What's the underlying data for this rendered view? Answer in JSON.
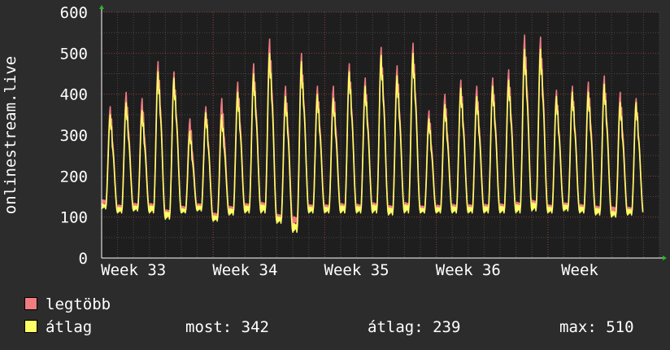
{
  "chart_data": {
    "type": "line",
    "ylabel": "onlinestream.live",
    "ylim": [
      0,
      600
    ],
    "yticks": [
      0,
      100,
      200,
      300,
      400,
      500,
      600
    ],
    "xlim": [
      0,
      35
    ],
    "xticks": [
      {
        "label": "Week 33",
        "day": 2
      },
      {
        "label": "Week 34",
        "day": 9
      },
      {
        "label": "Week 35",
        "day": 16
      },
      {
        "label": "Week 36",
        "day": 23
      },
      {
        "label": "Week",
        "day": 30
      }
    ],
    "grid": true,
    "colors": {
      "max": "#f07c80",
      "avg": "#ffff66"
    },
    "series": [
      {
        "name": "legtöbb",
        "key": "max",
        "daily_peaks": [
          370,
          405,
          390,
          480,
          455,
          340,
          370,
          390,
          430,
          475,
          535,
          420,
          500,
          420,
          420,
          475,
          440,
          515,
          470,
          525,
          360,
          400,
          435,
          420,
          440,
          460,
          545,
          540,
          410,
          420,
          430,
          445,
          405,
          390
        ],
        "daily_lows": [
          130,
          115,
          120,
          115,
          100,
          115,
          120,
          95,
          110,
          115,
          115,
          90,
          80,
          115,
          115,
          115,
          115,
          115,
          110,
          115,
          115,
          115,
          115,
          115,
          115,
          115,
          115,
          120,
          115,
          120,
          115,
          110,
          110,
          110
        ]
      },
      {
        "name": "átlag",
        "key": "avg",
        "daily_peaks": [
          350,
          380,
          360,
          455,
          440,
          310,
          355,
          350,
          405,
          450,
          500,
          395,
          480,
          400,
          390,
          455,
          420,
          495,
          445,
          500,
          340,
          375,
          415,
          395,
          420,
          435,
          510,
          510,
          395,
          405,
          405,
          425,
          380,
          380
        ],
        "daily_lows": [
          120,
          110,
          115,
          110,
          95,
          110,
          115,
          90,
          105,
          110,
          110,
          85,
          63,
          110,
          110,
          110,
          110,
          110,
          105,
          110,
          110,
          110,
          110,
          110,
          110,
          110,
          110,
          115,
          110,
          115,
          110,
          105,
          100,
          105
        ]
      }
    ]
  },
  "legend": {
    "items": [
      {
        "label": "legtöbb",
        "color": "#f07c80"
      },
      {
        "label": "átlag",
        "color": "#ffff66"
      }
    ],
    "stats": {
      "current": "most: 342",
      "average": "átlag: 239",
      "maximum": "max: 510"
    }
  }
}
